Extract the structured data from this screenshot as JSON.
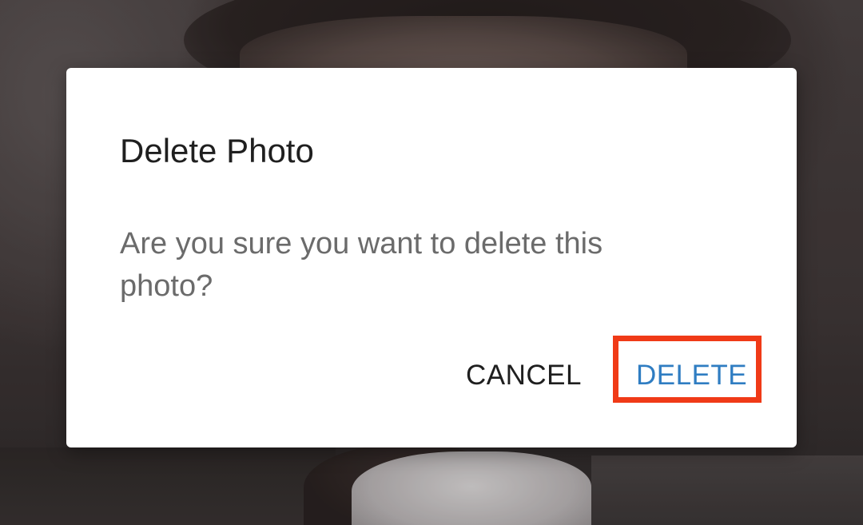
{
  "dialog": {
    "title": "Delete Photo",
    "message": "Are you sure you want to delete this photo?",
    "actions": {
      "cancel_label": "CANCEL",
      "delete_label": "DELETE"
    }
  },
  "colors": {
    "dialog_background": "#ffffff",
    "title_text": "#1f1f1f",
    "message_text": "#6b6b6b",
    "delete_accent": "#2f7dc2",
    "highlight_annotation": "#f03a17"
  }
}
